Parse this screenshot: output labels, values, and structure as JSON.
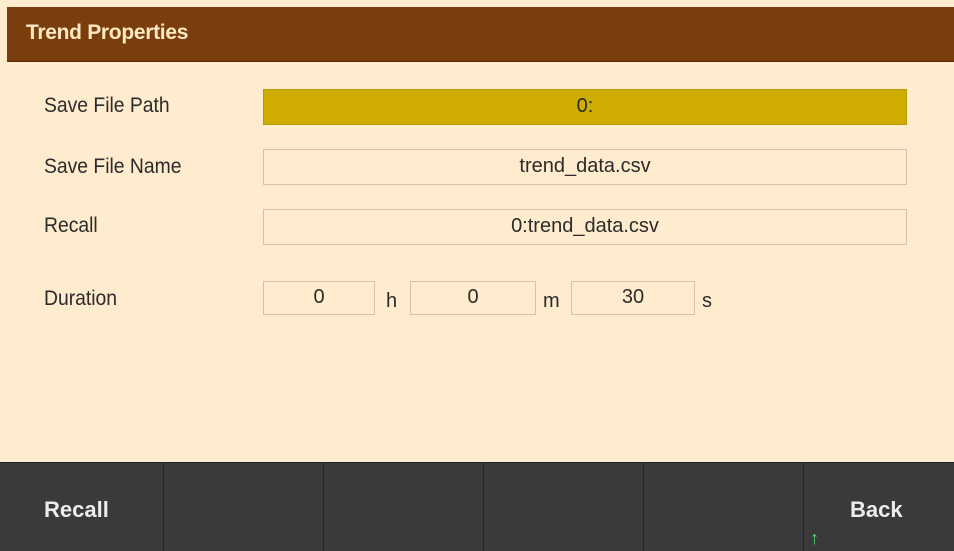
{
  "title": "Trend Properties",
  "fields": {
    "save_file_path": {
      "label": "Save File Path",
      "value": "0:"
    },
    "save_file_name": {
      "label": "Save File Name",
      "value": "trend_data.csv"
    },
    "recall": {
      "label": "Recall",
      "value": "0:trend_data.csv"
    },
    "duration": {
      "label": "Duration",
      "hours": "0",
      "hours_unit": "h",
      "minutes": "0",
      "minutes_unit": "m",
      "seconds": "30",
      "seconds_unit": "s"
    }
  },
  "softkeys": {
    "key1": "Recall",
    "key2": "",
    "key3": "",
    "key4": "",
    "key5": "",
    "key6": "Back",
    "key6_indicator": "↑"
  },
  "colors": {
    "background": "#ffebcd",
    "title_bar": "#7a3d0c",
    "title_text": "#ffe9c4",
    "selected_field": "#cfac00",
    "softkey_bar": "#3a3a3a",
    "indicator": "#4ee07a"
  }
}
